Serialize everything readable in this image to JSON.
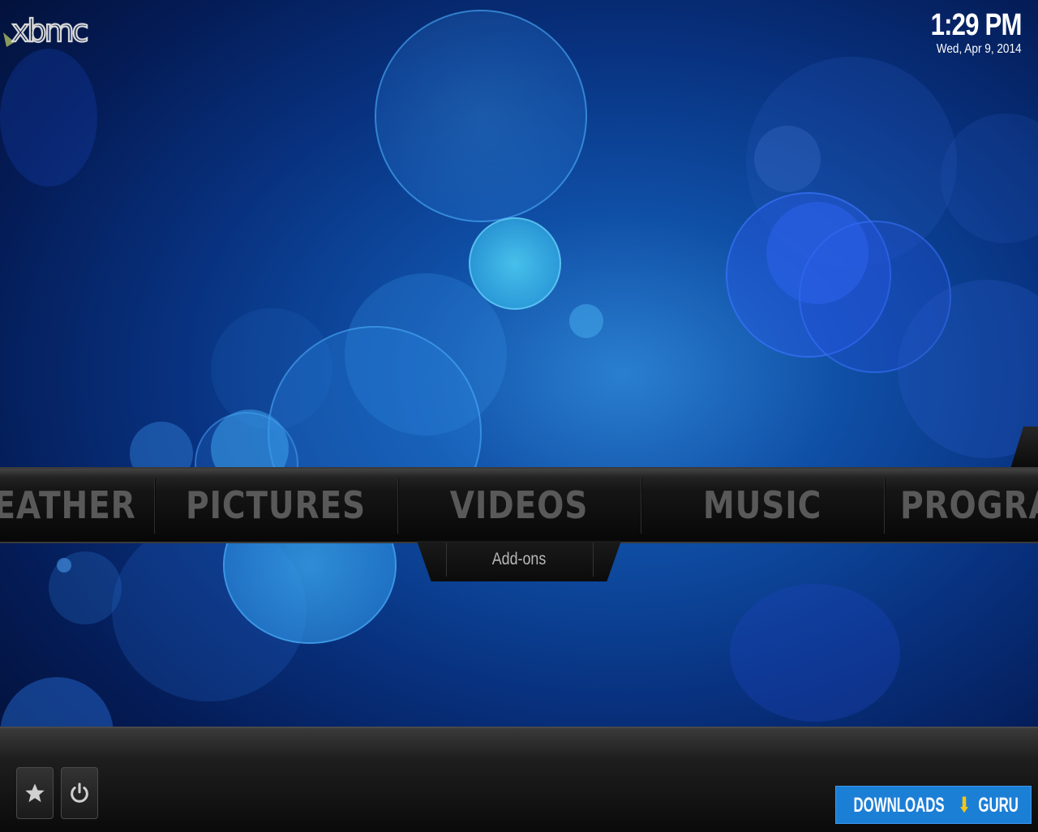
{
  "app": {
    "logo_text": "xbmc"
  },
  "clock": {
    "time": "1:29 PM",
    "date": "Wed, Apr 9, 2014"
  },
  "main_menu": {
    "items": [
      {
        "label": "EATHER"
      },
      {
        "label": "PICTURES"
      },
      {
        "label": "VIDEOS"
      },
      {
        "label": "MUSIC"
      },
      {
        "label": "PROGRA"
      }
    ],
    "selected": "VIDEOS"
  },
  "submenu": {
    "items": [
      {
        "label": "Add-ons"
      }
    ]
  },
  "bottom_bar": {
    "buttons": [
      {
        "icon": "star-icon"
      },
      {
        "icon": "power-icon"
      }
    ]
  },
  "watermark": {
    "left": "DOWNLOADS",
    "right": "GURU"
  },
  "colors": {
    "menu_text": "#595959",
    "accent": "#1c7fd6"
  }
}
